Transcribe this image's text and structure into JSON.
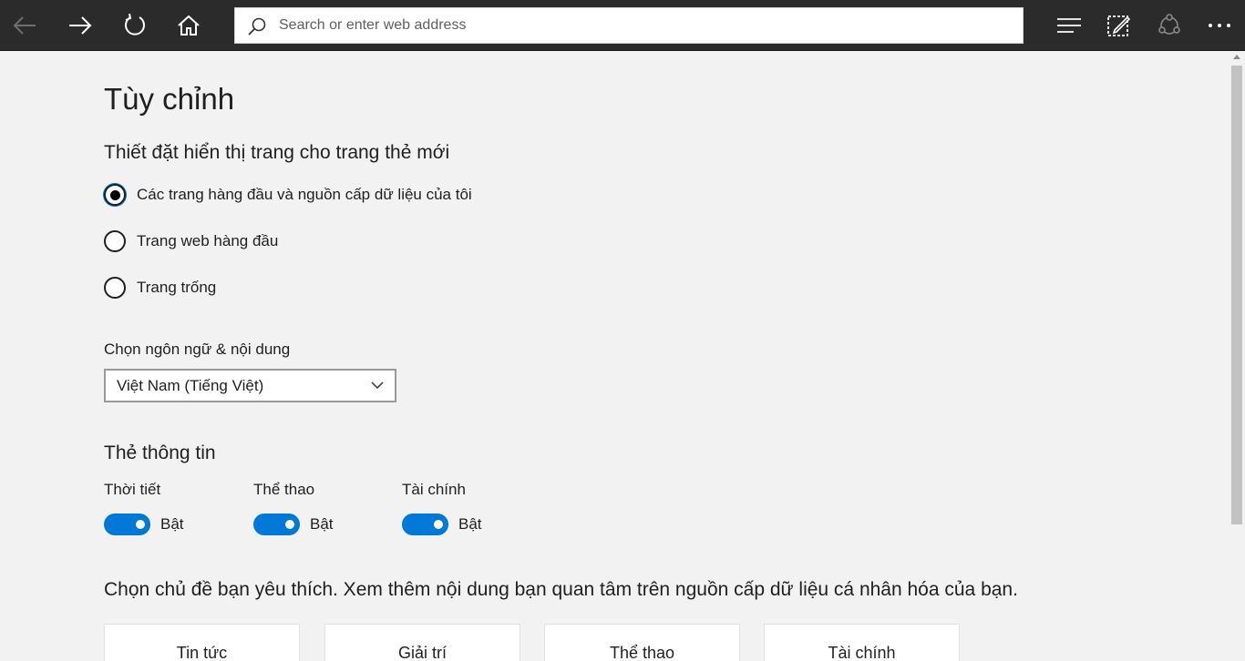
{
  "toolbar": {
    "back_icon": "back-arrow-icon",
    "forward_icon": "forward-arrow-icon",
    "refresh_icon": "refresh-icon",
    "home_icon": "home-icon",
    "search_placeholder": "Search or enter web address",
    "hub_icon": "hub-icon",
    "notes_icon": "web-note-icon",
    "share_icon": "share-icon",
    "more_icon": "more-icon"
  },
  "page": {
    "title": "Tùy chỉnh",
    "display_settings_title": "Thiết đặt hiển thị trang cho trang thẻ mới",
    "display_options": [
      {
        "label": "Các trang hàng đầu và nguồn cấp dữ liệu của tôi",
        "selected": true
      },
      {
        "label": "Trang web hàng đầu",
        "selected": false
      },
      {
        "label": "Trang trống",
        "selected": false
      }
    ],
    "language_label": "Chọn ngôn ngữ & nội dung",
    "language_value": "Việt Nam (Tiếng Việt)",
    "info_cards_title": "Thẻ thông tin",
    "info_cards": [
      {
        "label": "Thời tiết",
        "state": "Bật",
        "on": true
      },
      {
        "label": "Thể thao",
        "state": "Bật",
        "on": true
      },
      {
        "label": "Tài chính",
        "state": "Bật",
        "on": true
      }
    ],
    "topics_description": "Chọn chủ đề bạn yêu thích. Xem thêm nội dung bạn quan tâm trên nguồn cấp dữ liệu cá nhân hóa của bạn.",
    "topics": [
      "Tin tức",
      "Giải trí",
      "Thể thao",
      "Tài chính"
    ]
  },
  "colors": {
    "toolbar_bg": "#2b2b2b",
    "page_bg": "#f2f2f2",
    "accent": "#0078d7"
  }
}
